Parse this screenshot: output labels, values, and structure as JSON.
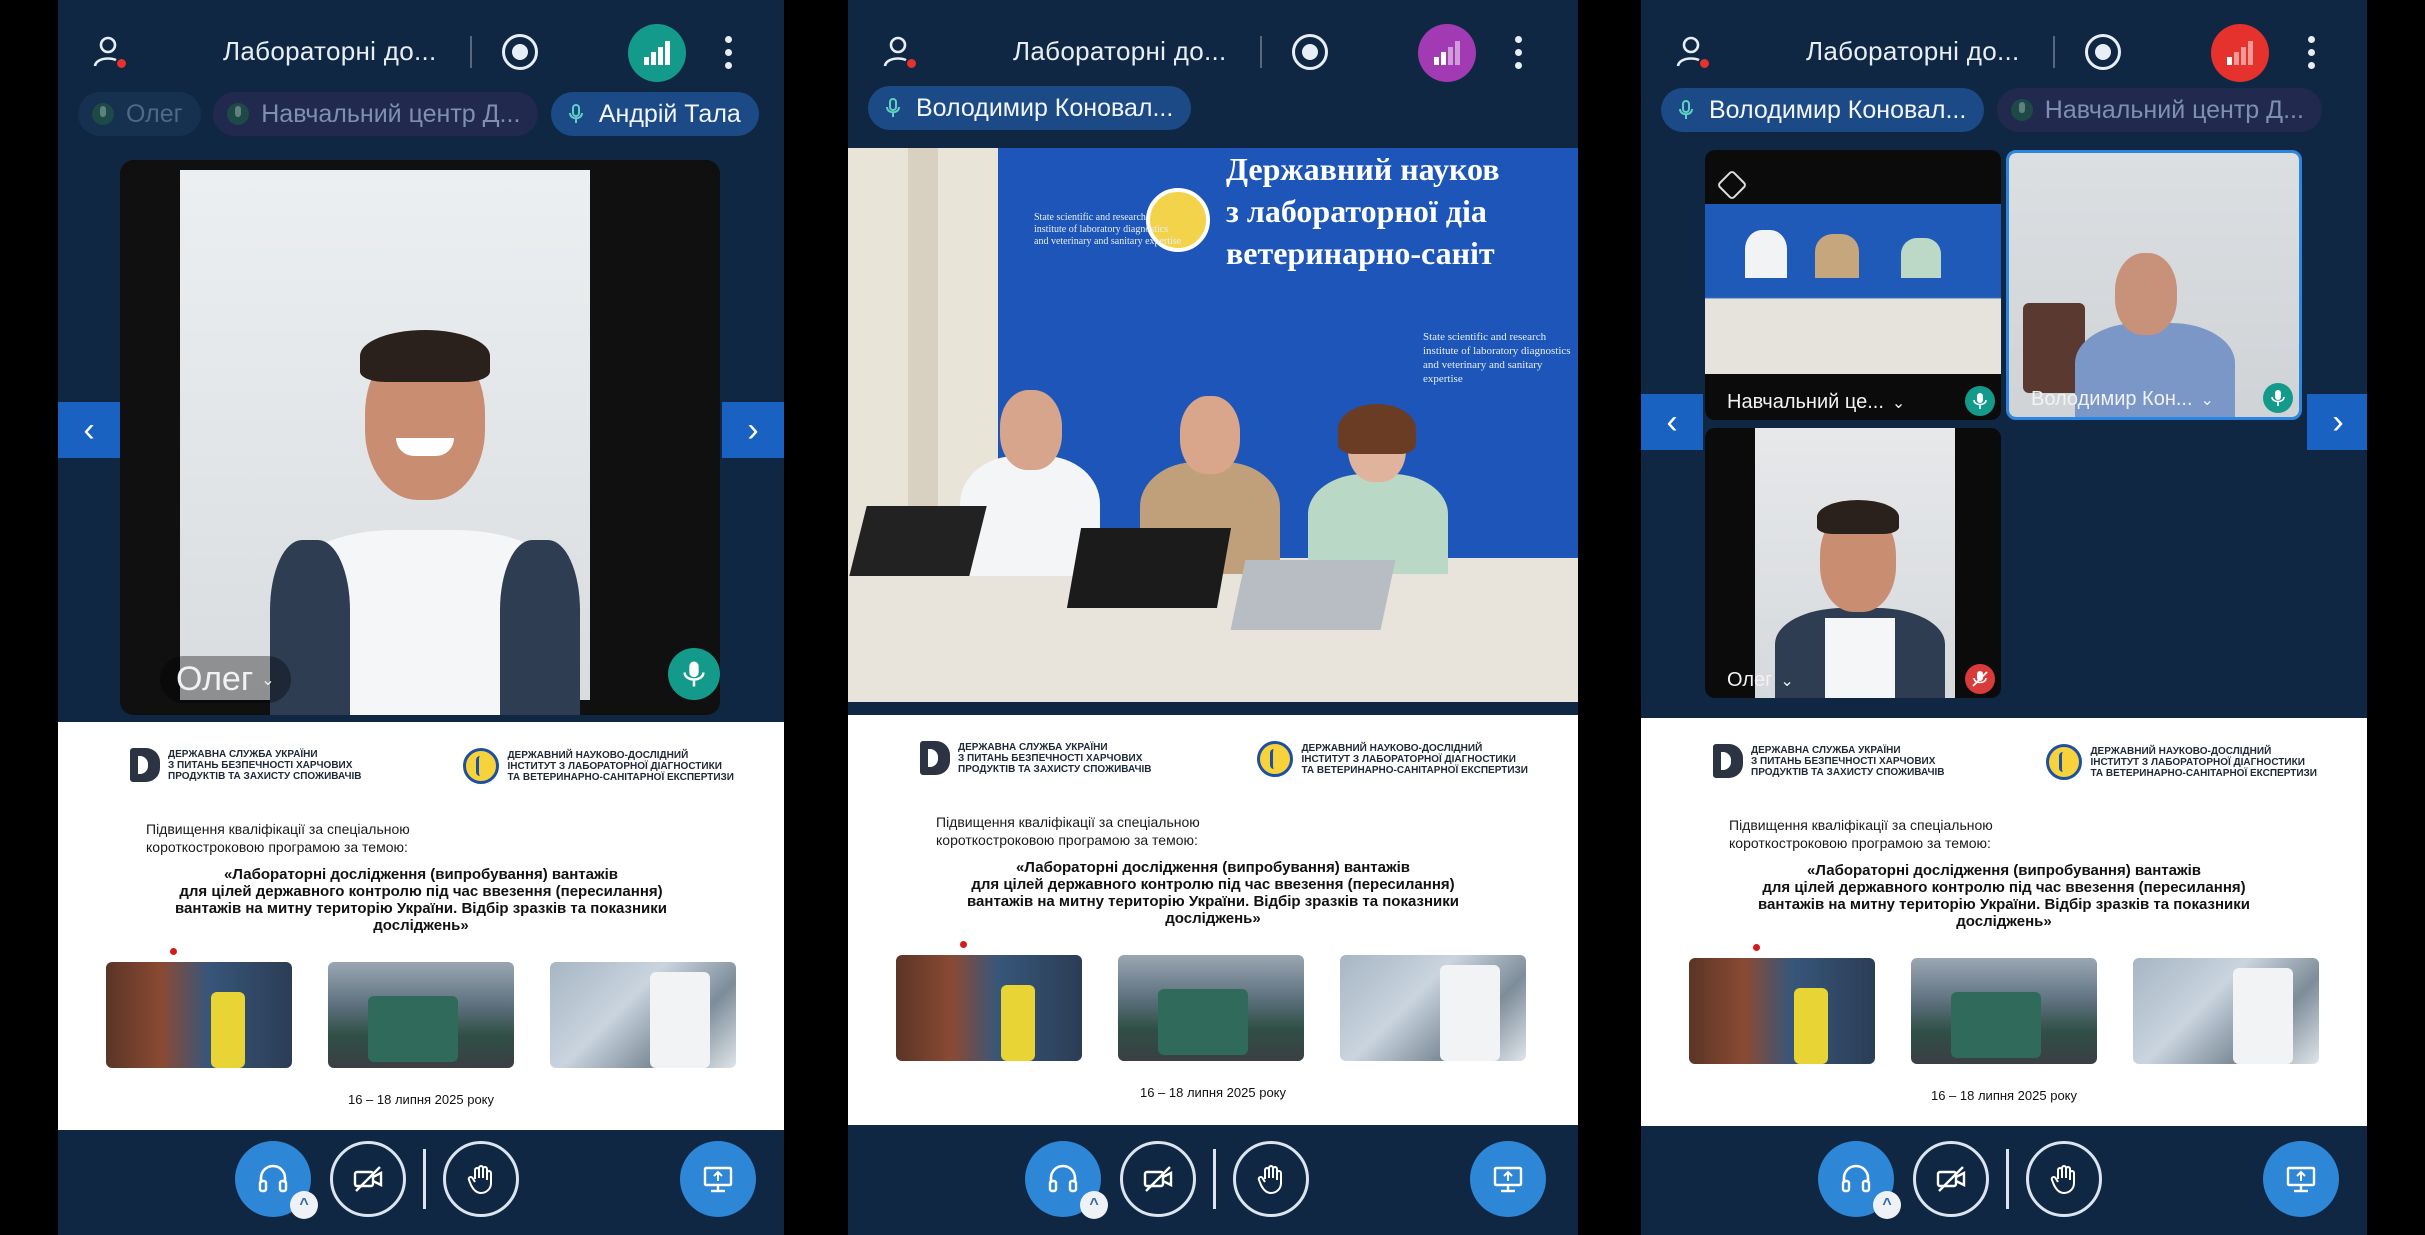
{
  "colors": {
    "background": "#0f2743",
    "accent": "#2d86d6",
    "conn_green": "#149a8a",
    "conn_purple": "#a23bb3",
    "conn_red": "#e5322c"
  },
  "phones": [
    {
      "topbar": {
        "title": "Лабораторні до...",
        "conn_color": "#149a8a"
      },
      "chips": [
        {
          "label": "Олег",
          "style": "dim"
        },
        {
          "label": "Навчальний центр Д...",
          "style": "dim2"
        },
        {
          "label": "Андрій Тала",
          "style": "active"
        }
      ],
      "video_tiles": [
        {
          "name": "Олег",
          "mic": "on"
        }
      ]
    },
    {
      "topbar": {
        "title": "Лабораторні до...",
        "conn_color": "#a23bb3"
      },
      "chips": [
        {
          "label": "Володимир Коновал...",
          "style": "active"
        }
      ],
      "banner": {
        "title_line1": "Державний науков",
        "title_line2": "з лабораторної діа",
        "title_line3": "ветеринарно-саніт",
        "en_line1": "State scientific and research",
        "en_line2": "institute of laboratory diagnostics",
        "en_line3": "and veterinary and sanitary expertise"
      }
    },
    {
      "topbar": {
        "title": "Лабораторні до...",
        "conn_color": "#e5322c"
      },
      "chips": [
        {
          "label": "Володимир Коновал...",
          "style": "active"
        },
        {
          "label": "Навчальний центр Д...",
          "style": "dim2"
        }
      ],
      "video_tiles": [
        {
          "name": "Навчальний це...",
          "mic": "on"
        },
        {
          "name": "Володимир Кон...",
          "mic": "on"
        },
        {
          "name": "Олег",
          "mic": "muted"
        }
      ]
    }
  ],
  "slide": {
    "logo_left": "ДЕРЖАВНА СЛУЖБА УКРАЇНИ З ПИТАНЬ БЕЗПЕЧНОСТІ ХАРЧОВИХ ПРОДУКТІВ ТА ЗАХИСТУ СПОЖИВАЧІВ",
    "logo_left_l1": "ДЕРЖАВНА СЛУЖБА УКРАЇНИ",
    "logo_left_l2": "З ПИТАНЬ БЕЗПЕЧНОСТІ ХАРЧОВИХ",
    "logo_left_l3": "ПРОДУКТІВ ТА ЗАХИСТУ СПОЖИВАЧІВ",
    "logo_right_l1": "ДЕРЖАВНИЙ НАУКОВО-ДОСЛІДНИЙ",
    "logo_right_l2": "ІНСТИТУТ З ЛАБОРАТОРНОЇ ДІАГНОСТИКИ",
    "logo_right_l3": "ТА ВЕТЕРИНАРНО-САНІТАРНОЇ ЕКСПЕРТИЗИ",
    "lead_l1": "Підвищення кваліфікації за спеціальною",
    "lead_l2": "короткостроковою програмою за темою:",
    "title_l1": "«Лабораторні дослідження (випробування) вантажів",
    "title_l2": "для цілей державного контролю під час ввезення (пересилання)",
    "title_l3": "вантажів на митну територію України. Відбір зразків та показники",
    "title_l4": "досліджень»",
    "date": "16 – 18 липня 2025 року"
  },
  "icons": {
    "user": "user-icon",
    "record": "record-icon",
    "connection": "signal-bars-icon",
    "more": "more-vertical-icon",
    "headphones": "headphones-icon",
    "camera_off": "camera-off-icon",
    "hand": "raise-hand-icon",
    "present": "screen-share-icon",
    "prev": "chevron-left-icon",
    "next": "chevron-right-icon"
  }
}
